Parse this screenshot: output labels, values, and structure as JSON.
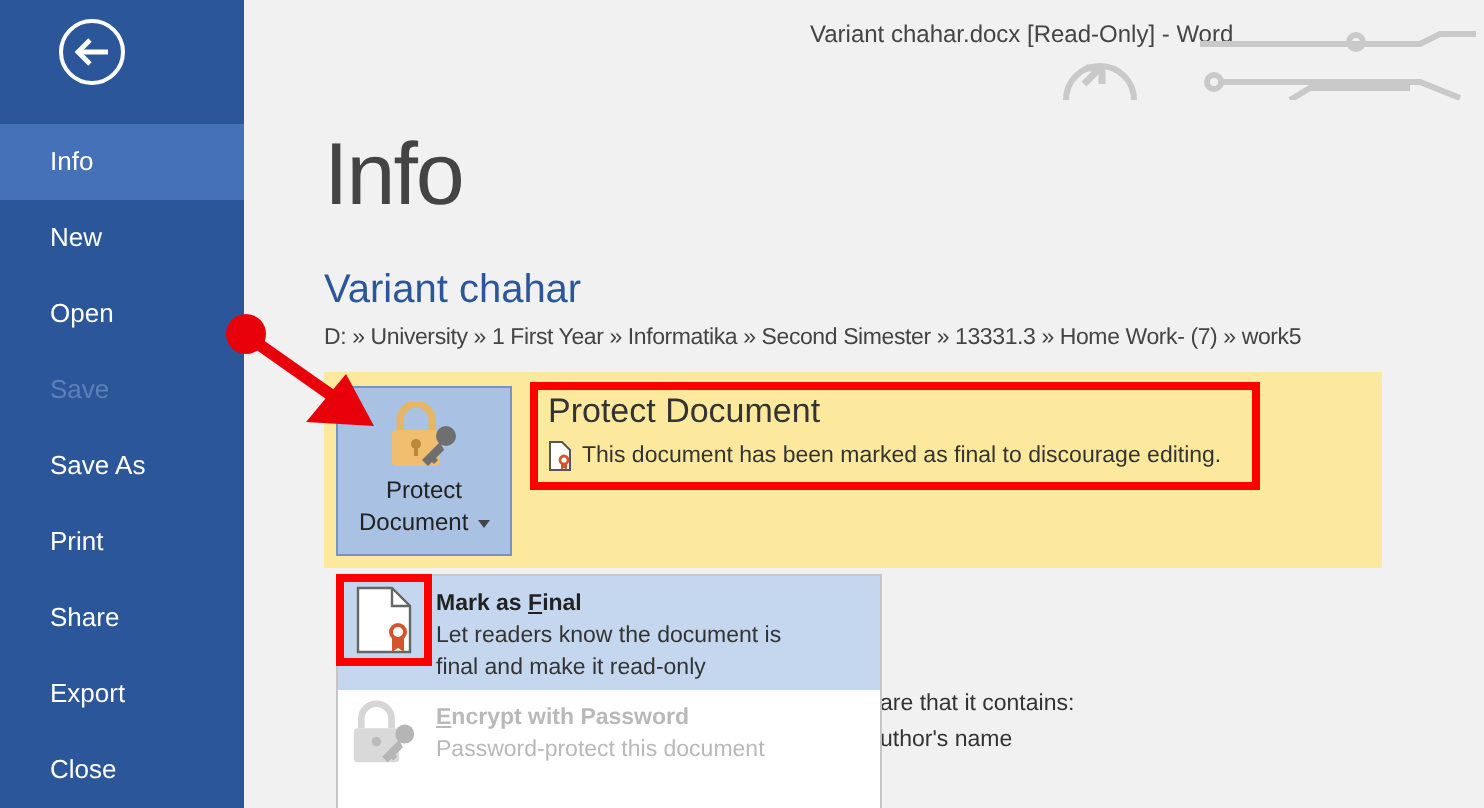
{
  "window": {
    "title": "Variant chahar.docx [Read-Only] - Word"
  },
  "sidebar": {
    "items": [
      {
        "label": "Info",
        "selected": true,
        "disabled": false
      },
      {
        "label": "New",
        "selected": false,
        "disabled": false
      },
      {
        "label": "Open",
        "selected": false,
        "disabled": false
      },
      {
        "label": "Save",
        "selected": false,
        "disabled": true
      },
      {
        "label": "Save As",
        "selected": false,
        "disabled": false
      },
      {
        "label": "Print",
        "selected": false,
        "disabled": false
      },
      {
        "label": "Share",
        "selected": false,
        "disabled": false
      },
      {
        "label": "Export",
        "selected": false,
        "disabled": false
      },
      {
        "label": "Close",
        "selected": false,
        "disabled": false
      }
    ]
  },
  "page": {
    "heading": "Info",
    "document_name": "Variant chahar",
    "path": "D: » University » 1 First Year » Informatika » Second Simester » 13331.3 » Home Work- (7) » work5"
  },
  "protect": {
    "button": [
      "Protect",
      "Document"
    ],
    "heading": "Protect Document",
    "message": "This document has been marked as final to discourage editing."
  },
  "menu": {
    "items": [
      {
        "kind": "document-ribbon",
        "title_plain": "Mark as ",
        "title_key": "F",
        "title_rest": "inal",
        "description": [
          "Let readers know the document is",
          "final and make it read-only"
        ],
        "selected": true,
        "disabled": false
      },
      {
        "kind": "lock-key",
        "title_key": "E",
        "title_rest": "ncrypt with Password",
        "description": [
          "Password-protect this document"
        ],
        "selected": false,
        "disabled": true
      }
    ]
  },
  "inspect": {
    "lines": [
      "are that it contains:",
      "uthor's name"
    ]
  }
}
